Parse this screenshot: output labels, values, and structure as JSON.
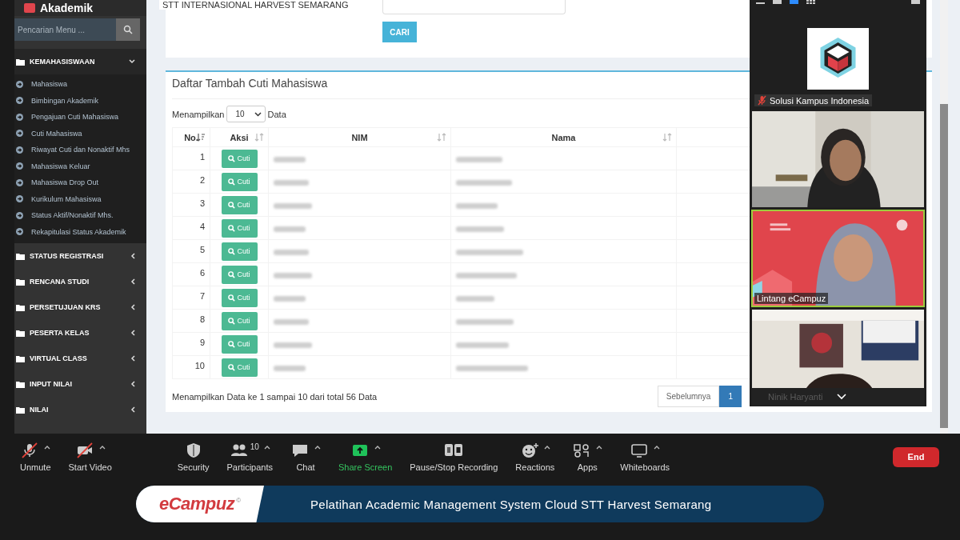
{
  "app": {
    "logo_text": "Akademik",
    "header_title": "STT INTERNASIONAL HARVEST SEMARANG"
  },
  "sidebar": {
    "search": {
      "placeholder": "Pencarian Menu ..."
    },
    "groups": [
      {
        "label": "KEMAHASISWAAN",
        "expanded": true,
        "children": [
          {
            "label": "Mahasiswa"
          },
          {
            "label": "Bimbingan Akademik"
          },
          {
            "label": "Pengajuan Cuti Mahasiswa"
          },
          {
            "label": "Cuti Mahasiswa"
          },
          {
            "label": "Riwayat Cuti dan Nonaktif Mhs"
          },
          {
            "label": "Mahasiswa Keluar"
          },
          {
            "label": "Mahasiswa Drop Out"
          },
          {
            "label": "Kurikulum Mahasiswa"
          },
          {
            "label": "Status Aktif/Nonaktif Mhs."
          },
          {
            "label": "Rekapitulasi Status Akademik"
          }
        ]
      },
      {
        "label": "STATUS REGISTRASI",
        "expanded": false
      },
      {
        "label": "RENCANA STUDI",
        "expanded": false
      },
      {
        "label": "PERSETUJUAN KRS",
        "expanded": false
      },
      {
        "label": "PESERTA KELAS",
        "expanded": false
      },
      {
        "label": "VIRTUAL CLASS",
        "expanded": false
      },
      {
        "label": "INPUT NILAI",
        "expanded": false
      },
      {
        "label": "NILAI",
        "expanded": false
      }
    ]
  },
  "search_form": {
    "button": "CARI"
  },
  "panel": {
    "title": "Daftar Tambah Cuti Mahasiswa",
    "length_prefix": "Menampilkan",
    "length_value": "10",
    "length_suffix": "Data",
    "columns": [
      {
        "label": "No.",
        "sorted": true
      },
      {
        "label": "Aksi",
        "sorted": false
      },
      {
        "label": "NIM",
        "sorted": false
      },
      {
        "label": "Nama",
        "sorted": false
      }
    ],
    "rows": [
      {
        "no": "1",
        "action": "Cuti"
      },
      {
        "no": "2",
        "action": "Cuti"
      },
      {
        "no": "3",
        "action": "Cuti"
      },
      {
        "no": "4",
        "action": "Cuti"
      },
      {
        "no": "5",
        "action": "Cuti"
      },
      {
        "no": "6",
        "action": "Cuti"
      },
      {
        "no": "7",
        "action": "Cuti"
      },
      {
        "no": "8",
        "action": "Cuti"
      },
      {
        "no": "9",
        "action": "Cuti"
      },
      {
        "no": "10",
        "action": "Cuti"
      }
    ],
    "info": "Menampilkan Data ke 1 sampai 10 dari total 56 Data",
    "pagination": [
      {
        "label": "Sebelumnya",
        "selected": false
      },
      {
        "label": "1",
        "selected": true
      }
    ]
  },
  "meeting_panel": {
    "tiles": [
      {
        "kind": "logo",
        "name": "Solusi Kampus Indonesia",
        "muted": true
      },
      {
        "kind": "video",
        "active_speaker": false
      },
      {
        "kind": "video",
        "name": "Lintang eCampuz",
        "active_speaker": true
      },
      {
        "kind": "video",
        "name": "Ninik Haryanti",
        "active_speaker": false
      }
    ]
  },
  "toolbar": {
    "items": [
      {
        "label": "Unmute",
        "off": true,
        "caret": true
      },
      {
        "label": "Start Video",
        "off": true,
        "caret": true
      },
      {
        "label": "Security",
        "off": false,
        "caret": false
      },
      {
        "label": "Participants",
        "off": false,
        "caret": true,
        "count": "10"
      },
      {
        "label": "Chat",
        "off": false,
        "caret": true
      },
      {
        "label": "Share Screen",
        "off": false,
        "caret": true
      },
      {
        "label": "Pause/Stop Recording",
        "off": false,
        "caret": false
      },
      {
        "label": "Reactions",
        "off": false,
        "caret": true
      },
      {
        "label": "Apps",
        "off": false,
        "caret": true
      },
      {
        "label": "Whiteboards",
        "off": false,
        "caret": true
      }
    ],
    "end_button": "End"
  },
  "banner": {
    "brand": "eCampuz",
    "brand_mark": "©",
    "title": "Pelatihan Academic Management System Cloud STT Harvest Semarang"
  }
}
